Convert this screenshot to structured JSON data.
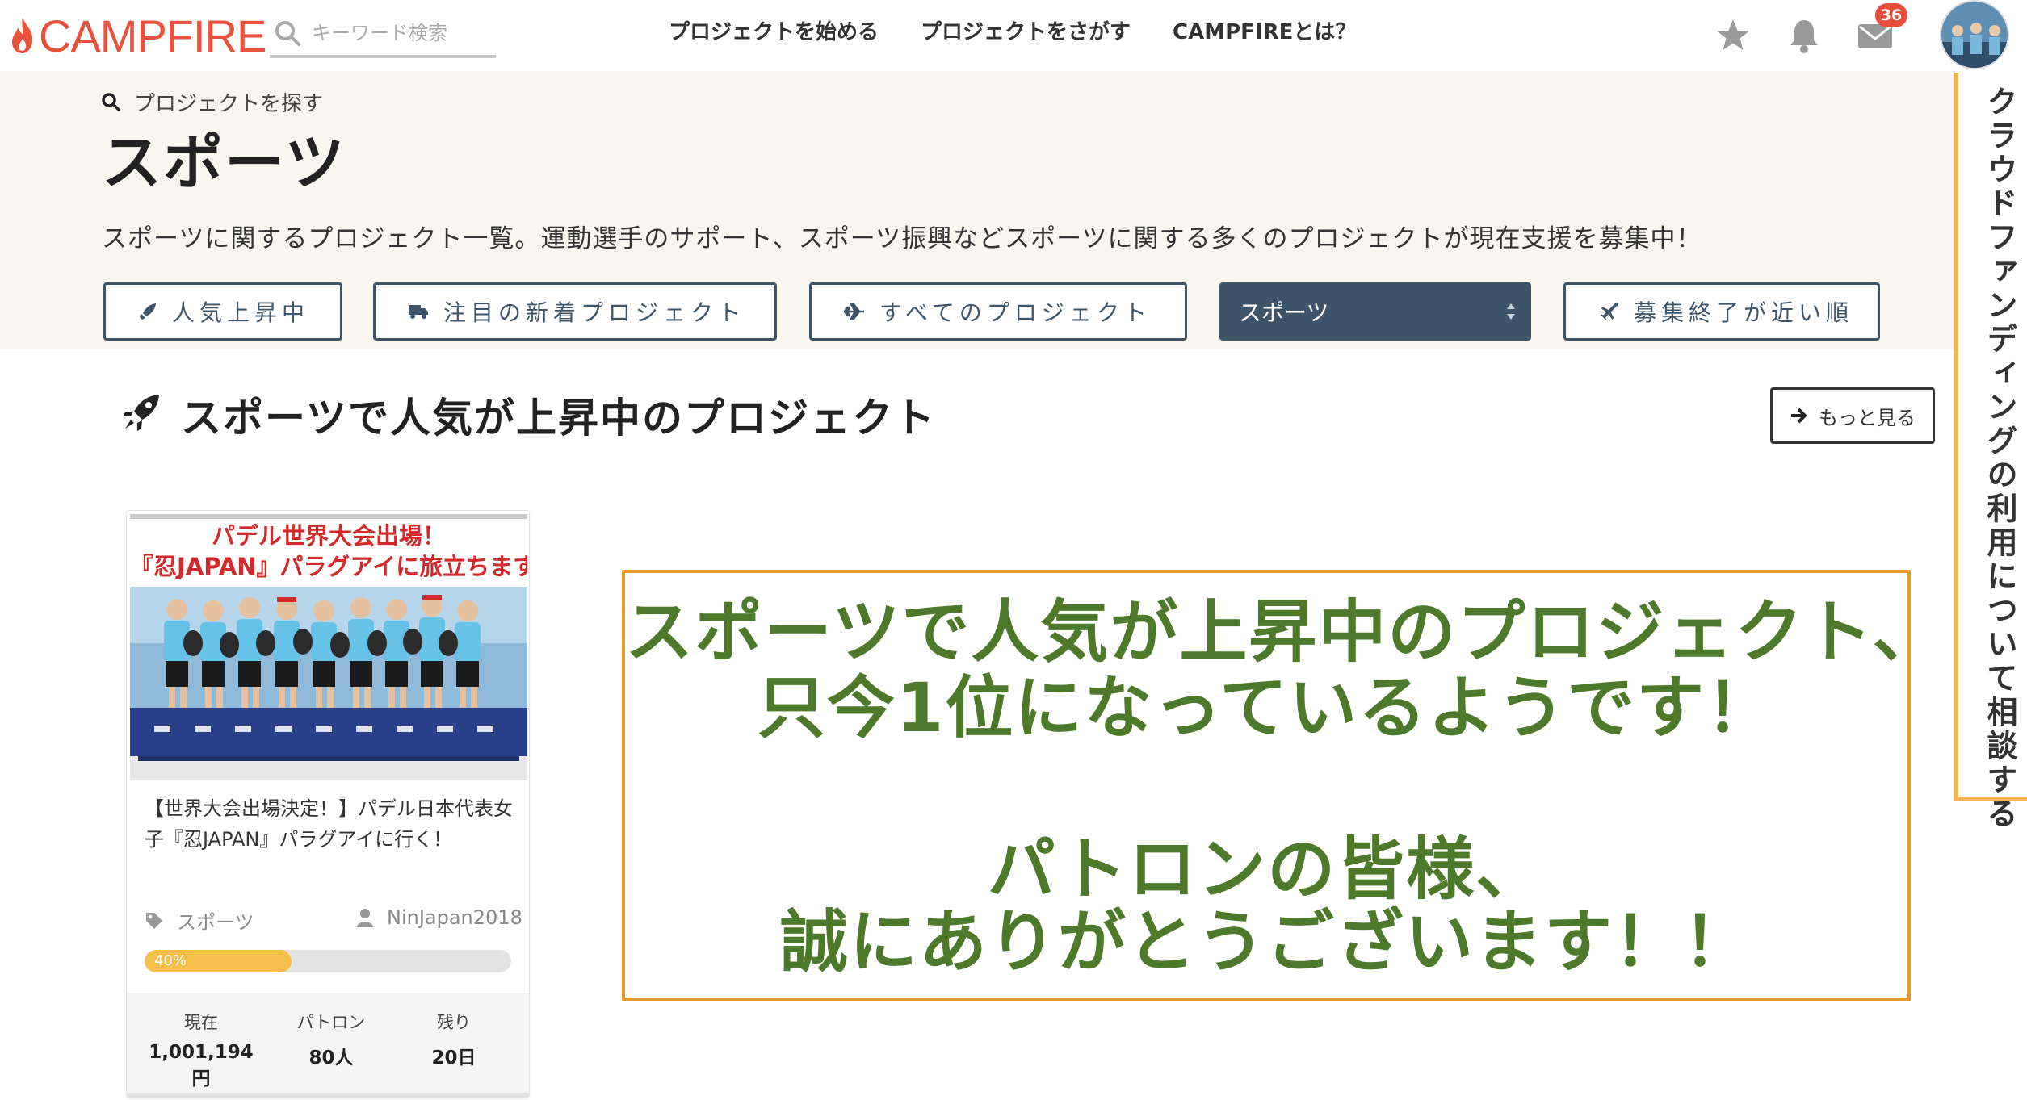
{
  "nav": {
    "logo_text": "CAMPFIRE",
    "search_placeholder": "キーワード検索",
    "links": [
      "プロジェクトを始める",
      "プロジェクトをさがす",
      "CAMPFIREとは？"
    ],
    "message_count": "36",
    "icons": [
      "star-icon",
      "bell-icon",
      "mail-icon"
    ]
  },
  "header": {
    "breadcrumb": "プロジェクトを探す",
    "title": "スポーツ",
    "description": "スポーツに関するプロジェクト一覧。運動選手のサポート、スポーツ振興などスポーツに関する多くのプロジェクトが現在支援を募集中！"
  },
  "filters": {
    "popular": "人気上昇中",
    "new": "注目の新着プロジェクト",
    "all": "すべてのプロジェクト",
    "category_selected": "スポーツ",
    "ending_soon": "募集終了が近い順"
  },
  "side_tab": {
    "label": "クラウドファンディングの利用について相談する"
  },
  "section": {
    "title": "スポーツで人気が上昇中のプロジェクト",
    "more_label": "もっと見る"
  },
  "card": {
    "image_headline_1": "パデル世界大会出場！",
    "image_headline_2": "『忍JAPAN』パラグアイに旅立ちます",
    "title": "【世界大会出場決定！】パデル日本代表女子『忍JAPAN』パラグアイに行く！",
    "category": "スポーツ",
    "owner": "NinJapan2018",
    "progress_label": "40%",
    "progress_fraction": 0.4,
    "stats": [
      {
        "label": "現在",
        "value": "1,001,194円"
      },
      {
        "label": "パトロン",
        "value": "80人"
      },
      {
        "label": "残り",
        "value": "20日"
      }
    ]
  },
  "annotation": {
    "line1": "スポーツで人気が上昇中のプロジェクト、",
    "line2": "只今1位になっているようです！",
    "line3": "パトロンの皆様、",
    "line4": "誠にありがとうございます！！"
  },
  "colors": {
    "brand": "#e8533f",
    "filter_dark": "#3e5468",
    "band_bg": "#f8f6ee",
    "accent_orange": "#e79a2c",
    "note_green": "#4d7a2a",
    "progress": "#f5bf4b"
  }
}
